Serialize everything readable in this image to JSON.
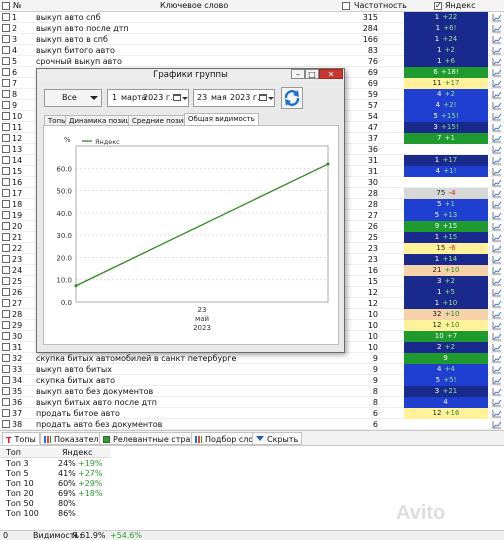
{
  "header": {
    "num": "№",
    "keyword": "Ключевое слово",
    "freq": "Частотность",
    "yandex": "Яндекс"
  },
  "rows": [
    {
      "n": "1",
      "kw": "выкуп авто спб",
      "f": "315",
      "p": "1",
      "d": "+22",
      "bg": "#1a2a8c",
      "fg": "#ffffff",
      "dc": "#8fe08f"
    },
    {
      "n": "2",
      "kw": "выкуп авто после дтп",
      "f": "284",
      "p": "1",
      "d": "+6!",
      "bg": "#1a2a8c",
      "fg": "#ffffff",
      "dc": "#8fe08f"
    },
    {
      "n": "3",
      "kw": "выкуп авто в спб",
      "f": "166",
      "p": "1",
      "d": "+24",
      "bg": "#1a2a8c",
      "fg": "#ffffff",
      "dc": "#8fe08f"
    },
    {
      "n": "4",
      "kw": "выкуп битого авто",
      "f": "83",
      "p": "1",
      "d": "+2",
      "bg": "#1a2a8c",
      "fg": "#ffffff",
      "dc": "#8fe08f"
    },
    {
      "n": "5",
      "kw": "срочный выкуп авто",
      "f": "76",
      "p": "1",
      "d": "+6",
      "bg": "#1a2a8c",
      "fg": "#ffffff",
      "dc": "#8fe08f"
    },
    {
      "n": "6",
      "kw": "",
      "f": "69",
      "p": "6",
      "d": "+18!",
      "bg": "#1f9a2f",
      "fg": "#ffffff",
      "dc": "#d8ffd8"
    },
    {
      "n": "7",
      "kw": "",
      "f": "69",
      "p": "11",
      "d": "+17",
      "bg": "#fff29a",
      "fg": "#222222",
      "dc": "#2d8a2d"
    },
    {
      "n": "8",
      "kw": "",
      "f": "59",
      "p": "4",
      "d": "+2",
      "bg": "#1f3fd0",
      "fg": "#ffffff",
      "dc": "#8fe08f"
    },
    {
      "n": "9",
      "kw": "",
      "f": "57",
      "p": "4",
      "d": "+2!",
      "bg": "#1f3fd0",
      "fg": "#ffffff",
      "dc": "#8fe08f"
    },
    {
      "n": "10",
      "kw": "",
      "f": "54",
      "p": "5",
      "d": "+15!",
      "bg": "#1f3fd0",
      "fg": "#ffffff",
      "dc": "#8fe08f"
    },
    {
      "n": "11",
      "kw": "",
      "f": "47",
      "p": "3",
      "d": "+15!",
      "bg": "#1a2a8c",
      "fg": "#ffffff",
      "dc": "#8fe08f"
    },
    {
      "n": "12",
      "kw": "",
      "f": "37",
      "p": "7",
      "d": "+1",
      "bg": "#1f9a2f",
      "fg": "#ffffff",
      "dc": "#d8ffd8"
    },
    {
      "n": "13",
      "kw": "",
      "f": "36",
      "p": "",
      "d": "",
      "bg": "",
      "fg": "#222222",
      "dc": "#222222"
    },
    {
      "n": "14",
      "kw": "",
      "f": "31",
      "p": "1",
      "d": "+17",
      "bg": "#1a2a8c",
      "fg": "#ffffff",
      "dc": "#8fe08f"
    },
    {
      "n": "15",
      "kw": "",
      "f": "31",
      "p": "4",
      "d": "+1!",
      "bg": "#1f3fd0",
      "fg": "#ffffff",
      "dc": "#8fe08f"
    },
    {
      "n": "16",
      "kw": "",
      "f": "30",
      "p": "",
      "d": "",
      "bg": "",
      "fg": "#222222",
      "dc": "#222222"
    },
    {
      "n": "17",
      "kw": "",
      "f": "28",
      "p": "75",
      "d": "-4",
      "bg": "#d7d7d7",
      "fg": "#222222",
      "dc": "#d02020"
    },
    {
      "n": "18",
      "kw": "",
      "f": "28",
      "p": "5",
      "d": "+1",
      "bg": "#1f3fd0",
      "fg": "#ffffff",
      "dc": "#8fe08f"
    },
    {
      "n": "19",
      "kw": "",
      "f": "27",
      "p": "5",
      "d": "+13",
      "bg": "#1f3fd0",
      "fg": "#ffffff",
      "dc": "#8fe08f"
    },
    {
      "n": "20",
      "kw": "",
      "f": "26",
      "p": "9",
      "d": "+15",
      "bg": "#1f9a2f",
      "fg": "#ffffff",
      "dc": "#d8ffd8"
    },
    {
      "n": "21",
      "kw": "",
      "f": "25",
      "p": "1",
      "d": "+15",
      "bg": "#1a2a8c",
      "fg": "#ffffff",
      "dc": "#8fe08f"
    },
    {
      "n": "22",
      "kw": "",
      "f": "23",
      "p": "15",
      "d": "-6",
      "bg": "#fff29a",
      "fg": "#222222",
      "dc": "#d02020"
    },
    {
      "n": "23",
      "kw": "",
      "f": "23",
      "p": "1",
      "d": "+14",
      "bg": "#1a2a8c",
      "fg": "#ffffff",
      "dc": "#8fe08f"
    },
    {
      "n": "24",
      "kw": "",
      "f": "16",
      "p": "21",
      "d": "+10",
      "bg": "#f6d2a8",
      "fg": "#222222",
      "dc": "#2d8a2d"
    },
    {
      "n": "25",
      "kw": "",
      "f": "15",
      "p": "3",
      "d": "+2",
      "bg": "#1a2a8c",
      "fg": "#ffffff",
      "dc": "#8fe08f"
    },
    {
      "n": "26",
      "kw": "",
      "f": "12",
      "p": "1",
      "d": "+5",
      "bg": "#1a2a8c",
      "fg": "#ffffff",
      "dc": "#8fe08f"
    },
    {
      "n": "27",
      "kw": "",
      "f": "12",
      "p": "1",
      "d": "+10",
      "bg": "#1a2a8c",
      "fg": "#ffffff",
      "dc": "#8fe08f"
    },
    {
      "n": "28",
      "kw": "",
      "f": "10",
      "p": "32",
      "d": "+10",
      "bg": "#f6d2a8",
      "fg": "#222222",
      "dc": "#2d8a2d"
    },
    {
      "n": "29",
      "kw": "",
      "f": "10",
      "p": "12",
      "d": "+10",
      "bg": "#fff29a",
      "fg": "#222222",
      "dc": "#2d8a2d"
    },
    {
      "n": "30",
      "kw": "",
      "f": "10",
      "p": "10",
      "d": "+7",
      "bg": "#1f9a2f",
      "fg": "#ffffff",
      "dc": "#d8ffd8"
    },
    {
      "n": "31",
      "kw": "",
      "f": "10",
      "p": "2",
      "d": "+2",
      "bg": "#1a2a8c",
      "fg": "#ffffff",
      "dc": "#8fe08f"
    },
    {
      "n": "32",
      "kw": "скупка битых автомобилей в санкт петербурге",
      "f": "9",
      "p": "9",
      "d": "",
      "bg": "#1f9a2f",
      "fg": "#ffffff",
      "dc": "#d8ffd8"
    },
    {
      "n": "33",
      "kw": "выкуп авто битых",
      "f": "9",
      "p": "4",
      "d": "+4",
      "bg": "#1f3fd0",
      "fg": "#ffffff",
      "dc": "#8fe08f"
    },
    {
      "n": "34",
      "kw": "скупка битых авто",
      "f": "9",
      "p": "5",
      "d": "+5!",
      "bg": "#1f3fd0",
      "fg": "#ffffff",
      "dc": "#8fe08f"
    },
    {
      "n": "35",
      "kw": "выкуп авто без документов",
      "f": "8",
      "p": "3",
      "d": "+21",
      "bg": "#1a2a8c",
      "fg": "#ffffff",
      "dc": "#8fe08f"
    },
    {
      "n": "36",
      "kw": "выкуп битых авто после дтп",
      "f": "8",
      "p": "4",
      "d": "",
      "bg": "#1f3fd0",
      "fg": "#ffffff",
      "dc": "#8fe08f"
    },
    {
      "n": "37",
      "kw": "продать битое авто",
      "f": "6",
      "p": "12",
      "d": "+16",
      "bg": "#fff29a",
      "fg": "#222222",
      "dc": "#2d8a2d"
    },
    {
      "n": "38",
      "kw": "продать авто без документов",
      "f": "6",
      "p": "",
      "d": "",
      "bg": "",
      "fg": "#222222",
      "dc": "#222222"
    }
  ],
  "tabs": [
    {
      "label": "Топы",
      "active": true,
      "icon": "letter-t-icon"
    },
    {
      "label": "Показатели",
      "active": false,
      "icon": "bar-chart-icon"
    },
    {
      "label": "Релевантные страницы",
      "active": false,
      "icon": "pages-icon"
    },
    {
      "label": "Подбор слов",
      "active": false,
      "icon": "bar-chart-icon"
    },
    {
      "label": "Скрыть",
      "active": false,
      "icon": "triangle-down-icon"
    }
  ],
  "tops": {
    "header": {
      "col1": "Топ",
      "col2": "Яндекс"
    },
    "rows": [
      {
        "label": "Топ 3",
        "val": "24%",
        "delta": "+19%"
      },
      {
        "label": "Топ 5",
        "val": "41%",
        "delta": "+27%"
      },
      {
        "label": "Топ 10",
        "val": "60%",
        "delta": "+29%"
      },
      {
        "label": "Топ 20",
        "val": "69%",
        "delta": "+18%"
      },
      {
        "label": "Топ 50",
        "val": "80%",
        "delta": ""
      },
      {
        "label": "Топ 100",
        "val": "86%",
        "delta": ""
      }
    ]
  },
  "status": {
    "count": "0",
    "visibility_label": "Видимость:",
    "visibility_val": "Я 61.9%",
    "visibility_delta": "+54.6%"
  },
  "watermark": "Avito",
  "dialog": {
    "title": "Графики группы",
    "group_select": "Все",
    "date_from": {
      "day": "1",
      "month": "марта",
      "year": "2023 г."
    },
    "date_to": {
      "day": "23",
      "month": "мая",
      "year": "2023 г."
    },
    "tabs": [
      "Топы",
      "Динамика позиций",
      "Средние позиции",
      "Общая видимость"
    ],
    "active_tab": 3
  },
  "chart_data": {
    "type": "line",
    "ylabel": "%",
    "legend_position": "top-left",
    "series": [
      {
        "name": "Яндекс",
        "color": "#2e8b1f",
        "x": [
          "2023-03-01",
          "2023-05-23"
        ],
        "values": [
          7.3,
          61.9
        ]
      }
    ],
    "yticks": [
      0,
      10,
      20,
      30,
      40,
      50,
      60
    ],
    "ylim": [
      0,
      70
    ],
    "grid": true,
    "xtick_label": {
      "day": "23",
      "month": "май",
      "year": "2023"
    }
  }
}
